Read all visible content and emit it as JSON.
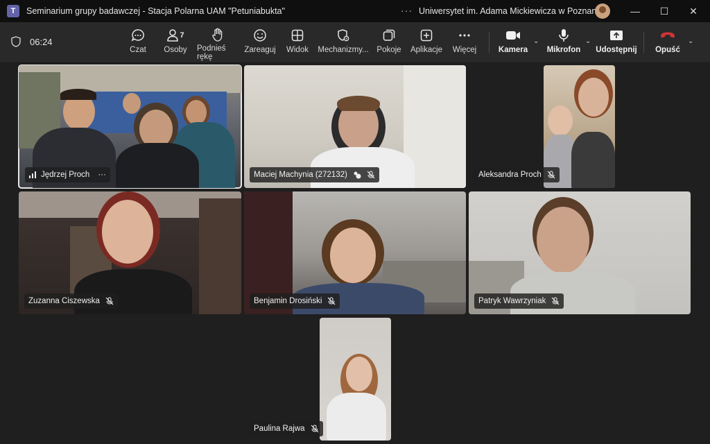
{
  "window": {
    "title": "Seminarium grupy badawczej - Stacja Polarna UAM \"Petuniabukta\"",
    "organization": "Uniwersytet im. Adama Mickiewicza w Poznaniu",
    "more": "···"
  },
  "toolbar": {
    "timer": "06:24",
    "buttons": [
      {
        "label": "Czat",
        "icon": "chat-icon"
      },
      {
        "label": "Osoby",
        "icon": "people-icon",
        "count": "7"
      },
      {
        "label": "Podnieś rękę",
        "icon": "raise-hand-icon"
      },
      {
        "label": "Zareaguj",
        "icon": "emoji-icon"
      },
      {
        "label": "Widok",
        "icon": "layout-icon"
      },
      {
        "label": "Mechanizmy...",
        "icon": "shield-settings-icon"
      },
      {
        "label": "Pokoje",
        "icon": "rooms-icon"
      },
      {
        "label": "Aplikacje",
        "icon": "add-apps-icon"
      },
      {
        "label": "Więcej",
        "icon": "more-icon"
      }
    ],
    "camera": "Kamera",
    "microphone": "Mikrofon",
    "share": "Udostępnij",
    "leave": "Opuść",
    "colors": {
      "leave": "#d13438",
      "background": "#292929"
    }
  },
  "participants": [
    {
      "name": "Jędrzej Proch",
      "more": "···"
    },
    {
      "name": "Maciej Machynia (272132)"
    },
    {
      "name": "Aleksandra Proch"
    },
    {
      "name": "Zuzanna Ciszewska"
    },
    {
      "name": "Benjamin Drosiński"
    },
    {
      "name": "Patryk Wawrzyniak"
    },
    {
      "name": "Paulina Rajwa"
    }
  ]
}
